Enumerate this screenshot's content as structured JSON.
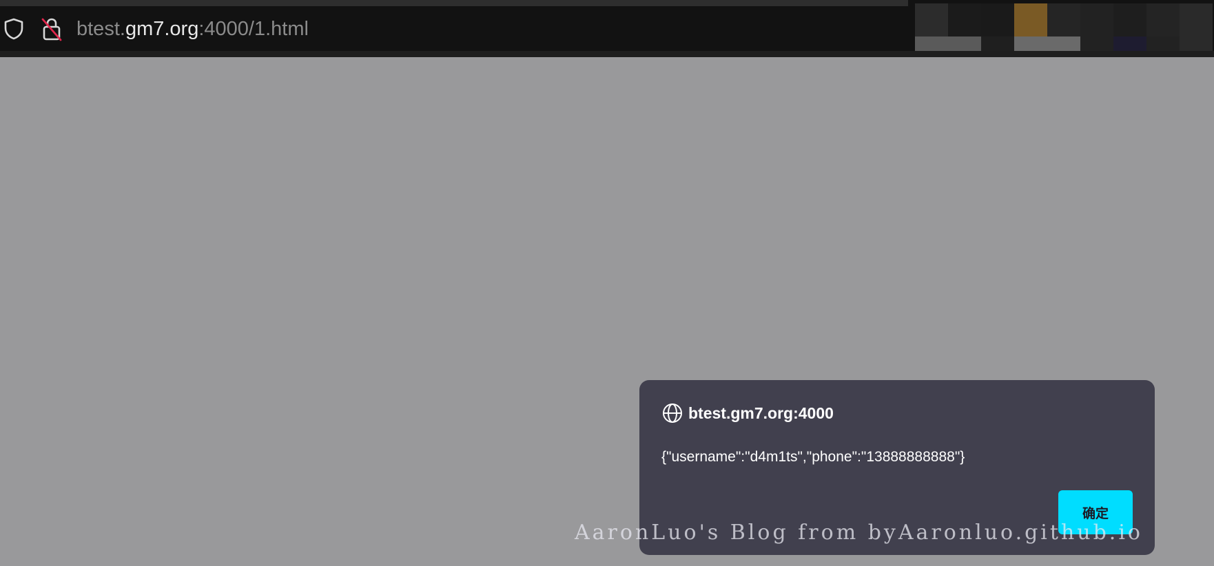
{
  "browser": {
    "url_prefix": "btest.",
    "url_host": "gm7.org",
    "url_suffix": ":4000/1.html",
    "icons": [
      "shield-icon",
      "insecure-lock-icon"
    ],
    "blurred_swatches": [
      "#2c2c2c",
      "#1b1b1b",
      "#1a1a1a",
      "#7a5a25",
      "#252525",
      "#222222",
      "#1e1e1e",
      "#242424",
      "#2a2a2a",
      "#5a5a5a",
      "#5a5a5a",
      "#1f1f1f",
      "#6a6a6a",
      "#6a6a6a",
      "#222222",
      "#1e1c30",
      "#222222",
      "#2a2a2a"
    ]
  },
  "dialog": {
    "origin": "btest.gm7.org:4000",
    "icon": "globe-icon",
    "message": "{\"username\":\"d4m1ts\",\"phone\":\"13888888888\"}",
    "ok_label": "确定",
    "accent_color": "#00ddff"
  },
  "watermark": {
    "text": "AaronLuo's Blog from byAaronluo.github.io"
  }
}
